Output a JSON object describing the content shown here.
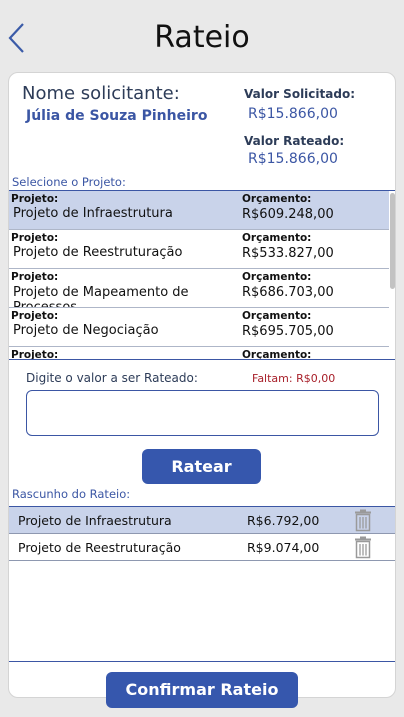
{
  "header": {
    "title": "Rateio",
    "back_icon": "chevron-left-icon"
  },
  "solicitante": {
    "label": "Nome solicitante:",
    "name": "Júlia de Souza Pinheiro",
    "valor_solicitado_label": "Valor Solicitado:",
    "valor_solicitado": "R$15.866,00",
    "valor_rateado_label": "Valor Rateado:",
    "valor_rateado": "R$15.866,00"
  },
  "projetos": {
    "section_label": "Selecione o Projeto:",
    "items": [
      {
        "label": "Projeto:",
        "name": "Projeto de Infraestrutura",
        "orcamento_label": "Orçamento:",
        "orcamento": "R$609.248,00",
        "selected": true
      },
      {
        "label": "Projeto:",
        "name": "Projeto de Reestruturação",
        "orcamento_label": "Orçamento:",
        "orcamento": "R$533.827,00",
        "selected": false
      },
      {
        "label": "Projeto:",
        "name": "Projeto de Mapeamento de Processos",
        "orcamento_label": "Orçamento:",
        "orcamento": "R$686.703,00",
        "selected": false
      },
      {
        "label": "Projeto:",
        "name": "Projeto de Negociação",
        "orcamento_label": "Orçamento:",
        "orcamento": "R$695.705,00",
        "selected": false
      },
      {
        "label": "Projeto:",
        "name": "",
        "orcamento_label": "Orçamento:",
        "orcamento": "",
        "selected": false
      }
    ]
  },
  "rateio_input": {
    "label": "Digite o valor a ser Rateado:",
    "faltam": "Faltam: R$0,00",
    "value": "",
    "placeholder": ""
  },
  "buttons": {
    "ratear": "Ratear",
    "confirmar": "Confirmar Rateio"
  },
  "rascunho": {
    "section_label": "Rascunho do Rateio:",
    "items": [
      {
        "name": "Projeto de Infraestrutura",
        "valor": "R$6.792,00",
        "selected": true,
        "icon": "trash-icon"
      },
      {
        "name": "Projeto de Reestruturação",
        "valor": "R$9.074,00",
        "selected": false,
        "icon": "trash-icon"
      }
    ]
  },
  "colors": {
    "accent": "#3657ad",
    "selected_row": "#c9d3ea",
    "warning": "#a8202a"
  }
}
